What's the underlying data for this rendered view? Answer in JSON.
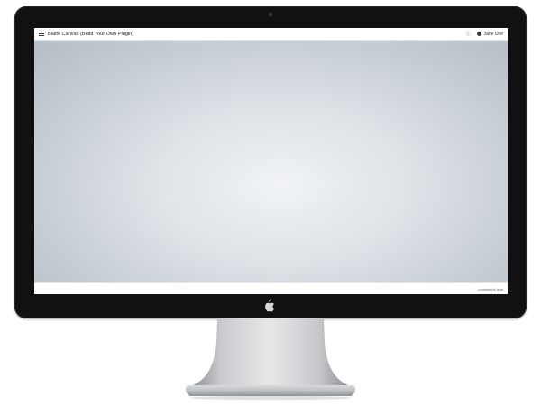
{
  "app": {
    "title": "Blank Canvas (Build Your Own Plugin)",
    "user_name": "Jane Doe"
  },
  "icons": {
    "menu": "hamburger-menu-icon",
    "info": "info-icon",
    "user": "user-account-icon",
    "brand": "apple-logo-icon"
  },
  "status": {
    "connection": "connected: true"
  },
  "colors": {
    "bezel": "#111111",
    "topbar": "#ffffff",
    "canvas_center": "#f1f3f5",
    "canvas_edge": "#b3bdc4"
  }
}
